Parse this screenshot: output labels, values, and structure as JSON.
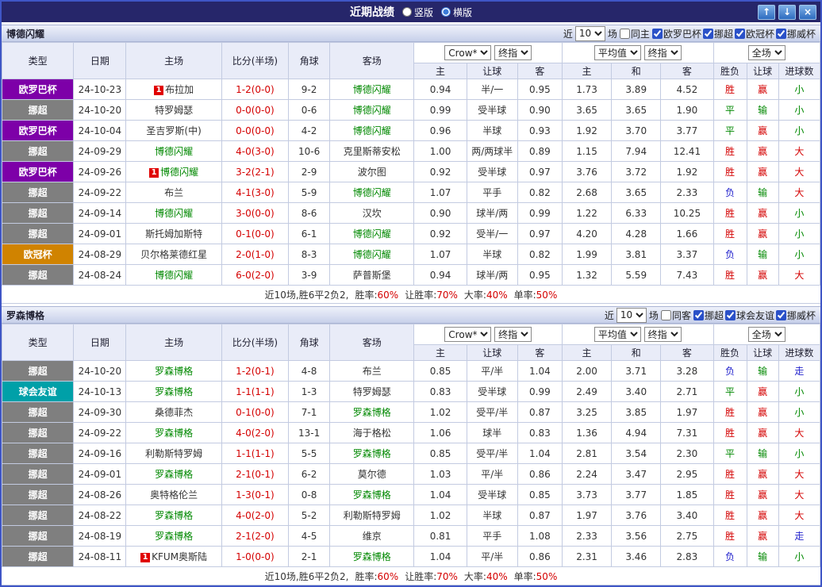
{
  "title_bar": {
    "title": "近期战绩",
    "radios": [
      {
        "label": "竖版",
        "checked": false
      },
      {
        "label": "横版",
        "checked": true
      }
    ],
    "buttons": [
      {
        "name": "scroll-up",
        "glyph": "↑"
      },
      {
        "name": "scroll-down",
        "glyph": "↓"
      },
      {
        "name": "close",
        "glyph": "×"
      }
    ]
  },
  "table_headers": {
    "left": [
      "类型",
      "日期",
      "主场",
      "比分(半场)",
      "角球",
      "客场"
    ],
    "group1": [
      "Crow*",
      "终指"
    ],
    "group2": [
      "平均值",
      "终指"
    ],
    "group3": [
      "全场"
    ],
    "sub": [
      "主",
      "让球",
      "客",
      "主",
      "和",
      "客",
      "胜负",
      "让球",
      "进球数"
    ]
  },
  "colors": {
    "types": {
      "挪超": "#7f7f7f",
      "欧罗巴杯": "#7d00a8",
      "欧冠杯": "#d08300",
      "球会友谊": "#00a0a8"
    },
    "result_map": {
      "胜": "#d40000",
      "平": "#008800",
      "负": "#2222cc",
      "赢": "#d40000",
      "输": "#008800",
      "走": "#2222cc",
      "大": "#d40000",
      "小": "#008800"
    }
  },
  "sections": [
    {
      "team": "博德闪耀",
      "filter": {
        "near": "近",
        "count": "10",
        "games": "场",
        "same": "同主",
        "same_checked": false,
        "comps": [
          "欧罗巴杯",
          "挪超",
          "欧冠杯",
          "挪威杯"
        ]
      },
      "rows": [
        {
          "type": "欧罗巴杯",
          "date": "24-10-23",
          "home_badge": "1",
          "home": "布拉加",
          "home_focus": false,
          "score": "1-2(0-0)",
          "corners": "9-2",
          "away": "博德闪耀",
          "away_focus": true,
          "odds": [
            "0.94",
            "半/一",
            "0.95"
          ],
          "avg": [
            "1.73",
            "3.89",
            "4.52"
          ],
          "result": [
            "胜",
            "赢",
            "小"
          ]
        },
        {
          "type": "挪超",
          "date": "24-10-20",
          "home": "特罗姆瑟",
          "home_focus": false,
          "score": "0-0(0-0)",
          "corners": "0-6",
          "away": "博德闪耀",
          "away_focus": true,
          "odds": [
            "0.99",
            "受半球",
            "0.90"
          ],
          "avg": [
            "3.65",
            "3.65",
            "1.90"
          ],
          "result": [
            "平",
            "输",
            "小"
          ]
        },
        {
          "type": "欧罗巴杯",
          "date": "24-10-04",
          "home": "圣吉罗斯(中)",
          "home_focus": false,
          "score": "0-0(0-0)",
          "corners": "4-2",
          "away": "博德闪耀",
          "away_focus": true,
          "odds": [
            "0.96",
            "半球",
            "0.93"
          ],
          "avg": [
            "1.92",
            "3.70",
            "3.77"
          ],
          "result": [
            "平",
            "赢",
            "小"
          ]
        },
        {
          "type": "挪超",
          "date": "24-09-29",
          "home": "博德闪耀",
          "home_focus": true,
          "score": "4-0(3-0)",
          "corners": "10-6",
          "away": "克里斯蒂安松",
          "away_focus": false,
          "odds": [
            "1.00",
            "两/两球半",
            "0.89"
          ],
          "avg": [
            "1.15",
            "7.94",
            "12.41"
          ],
          "result": [
            "胜",
            "赢",
            "大"
          ]
        },
        {
          "type": "欧罗巴杯",
          "date": "24-09-26",
          "home_badge": "1",
          "home": "博德闪耀",
          "home_focus": true,
          "score": "3-2(2-1)",
          "corners": "2-9",
          "away": "波尔图",
          "away_focus": false,
          "odds": [
            "0.92",
            "受半球",
            "0.97"
          ],
          "avg": [
            "3.76",
            "3.72",
            "1.92"
          ],
          "result": [
            "胜",
            "赢",
            "大"
          ]
        },
        {
          "type": "挪超",
          "date": "24-09-22",
          "home": "布兰",
          "home_focus": false,
          "score": "4-1(3-0)",
          "corners": "5-9",
          "away": "博德闪耀",
          "away_focus": true,
          "odds": [
            "1.07",
            "平手",
            "0.82"
          ],
          "avg": [
            "2.68",
            "3.65",
            "2.33"
          ],
          "result": [
            "负",
            "输",
            "大"
          ]
        },
        {
          "type": "挪超",
          "date": "24-09-14",
          "home": "博德闪耀",
          "home_focus": true,
          "score": "3-0(0-0)",
          "corners": "8-6",
          "away": "汉坎",
          "away_focus": false,
          "odds": [
            "0.90",
            "球半/两",
            "0.99"
          ],
          "avg": [
            "1.22",
            "6.33",
            "10.25"
          ],
          "result": [
            "胜",
            "赢",
            "小"
          ]
        },
        {
          "type": "挪超",
          "date": "24-09-01",
          "home": "斯托姆加斯特",
          "home_focus": false,
          "score": "0-1(0-0)",
          "corners": "6-1",
          "away": "博德闪耀",
          "away_focus": true,
          "odds": [
            "0.92",
            "受半/一",
            "0.97"
          ],
          "avg": [
            "4.20",
            "4.28",
            "1.66"
          ],
          "result": [
            "胜",
            "赢",
            "小"
          ]
        },
        {
          "type": "欧冠杯",
          "date": "24-08-29",
          "home": "贝尔格莱德红星",
          "home_focus": false,
          "score": "2-0(1-0)",
          "corners": "8-3",
          "away": "博德闪耀",
          "away_focus": true,
          "odds": [
            "1.07",
            "半球",
            "0.82"
          ],
          "avg": [
            "1.99",
            "3.81",
            "3.37"
          ],
          "result": [
            "负",
            "输",
            "小"
          ]
        },
        {
          "type": "挪超",
          "date": "24-08-24",
          "home": "博德闪耀",
          "home_focus": true,
          "score": "6-0(2-0)",
          "corners": "3-9",
          "away": "萨普斯堡",
          "away_focus": false,
          "odds": [
            "0.94",
            "球半/两",
            "0.95"
          ],
          "avg": [
            "1.32",
            "5.59",
            "7.43"
          ],
          "result": [
            "胜",
            "赢",
            "大"
          ]
        }
      ],
      "footer": {
        "prefix": "近10场,胜6平2负2,",
        "stats": [
          {
            "label": "胜率:",
            "value": "60%"
          },
          {
            "label": "让胜率:",
            "value": "70%"
          },
          {
            "label": "大率:",
            "value": "40%"
          },
          {
            "label": "单率:",
            "value": "50%"
          }
        ]
      }
    },
    {
      "team": "罗森博格",
      "filter": {
        "near": "近",
        "count": "10",
        "games": "场",
        "same": "同客",
        "same_checked": false,
        "comps": [
          "挪超",
          "球会友谊",
          "挪威杯"
        ]
      },
      "rows": [
        {
          "type": "挪超",
          "date": "24-10-20",
          "home": "罗森博格",
          "home_focus": true,
          "score": "1-2(0-1)",
          "corners": "4-8",
          "away": "布兰",
          "away_focus": false,
          "odds": [
            "0.85",
            "平/半",
            "1.04"
          ],
          "avg": [
            "2.00",
            "3.71",
            "3.28"
          ],
          "result": [
            "负",
            "输",
            "走"
          ]
        },
        {
          "type": "球会友谊",
          "date": "24-10-13",
          "home": "罗森博格",
          "home_focus": true,
          "score": "1-1(1-1)",
          "corners": "1-3",
          "away": "特罗姆瑟",
          "away_focus": false,
          "odds": [
            "0.83",
            "受半球",
            "0.99"
          ],
          "avg": [
            "2.49",
            "3.40",
            "2.71"
          ],
          "result": [
            "平",
            "赢",
            "小"
          ]
        },
        {
          "type": "挪超",
          "date": "24-09-30",
          "home": "桑德菲杰",
          "home_focus": false,
          "score": "0-1(0-0)",
          "corners": "7-1",
          "away": "罗森博格",
          "away_focus": true,
          "odds": [
            "1.02",
            "受平/半",
            "0.87"
          ],
          "avg": [
            "3.25",
            "3.85",
            "1.97"
          ],
          "result": [
            "胜",
            "赢",
            "小"
          ]
        },
        {
          "type": "挪超",
          "date": "24-09-22",
          "home": "罗森博格",
          "home_focus": true,
          "score": "4-0(2-0)",
          "corners": "13-1",
          "away": "海于格松",
          "away_focus": false,
          "odds": [
            "1.06",
            "球半",
            "0.83"
          ],
          "avg": [
            "1.36",
            "4.94",
            "7.31"
          ],
          "result": [
            "胜",
            "赢",
            "大"
          ]
        },
        {
          "type": "挪超",
          "date": "24-09-16",
          "home": "利勒斯特罗姆",
          "home_focus": false,
          "score": "1-1(1-1)",
          "corners": "5-5",
          "away": "罗森博格",
          "away_focus": true,
          "odds": [
            "0.85",
            "受平/半",
            "1.04"
          ],
          "avg": [
            "2.81",
            "3.54",
            "2.30"
          ],
          "result": [
            "平",
            "输",
            "小"
          ]
        },
        {
          "type": "挪超",
          "date": "24-09-01",
          "home": "罗森博格",
          "home_focus": true,
          "score": "2-1(0-1)",
          "corners": "6-2",
          "away": "莫尔德",
          "away_focus": false,
          "odds": [
            "1.03",
            "平/半",
            "0.86"
          ],
          "avg": [
            "2.24",
            "3.47",
            "2.95"
          ],
          "result": [
            "胜",
            "赢",
            "大"
          ]
        },
        {
          "type": "挪超",
          "date": "24-08-26",
          "home": "奥特格伦兰",
          "home_focus": false,
          "score": "1-3(0-1)",
          "corners": "0-8",
          "away": "罗森博格",
          "away_focus": true,
          "odds": [
            "1.04",
            "受半球",
            "0.85"
          ],
          "avg": [
            "3.73",
            "3.77",
            "1.85"
          ],
          "result": [
            "胜",
            "赢",
            "大"
          ]
        },
        {
          "type": "挪超",
          "date": "24-08-22",
          "home": "罗森博格",
          "home_focus": true,
          "score": "4-0(2-0)",
          "corners": "5-2",
          "away": "利勒斯特罗姆",
          "away_focus": false,
          "odds": [
            "1.02",
            "半球",
            "0.87"
          ],
          "avg": [
            "1.97",
            "3.76",
            "3.40"
          ],
          "result": [
            "胜",
            "赢",
            "大"
          ]
        },
        {
          "type": "挪超",
          "date": "24-08-19",
          "home": "罗森博格",
          "home_focus": true,
          "score": "2-1(2-0)",
          "corners": "4-5",
          "away": "维京",
          "away_focus": false,
          "odds": [
            "0.81",
            "平手",
            "1.08"
          ],
          "avg": [
            "2.33",
            "3.56",
            "2.75"
          ],
          "result": [
            "胜",
            "赢",
            "走"
          ]
        },
        {
          "type": "挪超",
          "date": "24-08-11",
          "home_badge": "1",
          "home": "KFUM奥斯陆",
          "home_focus": false,
          "score": "1-0(0-0)",
          "corners": "2-1",
          "away": "罗森博格",
          "away_focus": true,
          "odds": [
            "1.04",
            "平/半",
            "0.86"
          ],
          "avg": [
            "2.31",
            "3.46",
            "2.83"
          ],
          "result": [
            "负",
            "输",
            "小"
          ]
        }
      ],
      "footer": {
        "prefix": "近10场,胜6平2负2,",
        "stats": [
          {
            "label": "胜率:",
            "value": "60%"
          },
          {
            "label": "让胜率:",
            "value": "70%"
          },
          {
            "label": "大率:",
            "value": "40%"
          },
          {
            "label": "单率:",
            "value": "50%"
          }
        ]
      }
    }
  ]
}
